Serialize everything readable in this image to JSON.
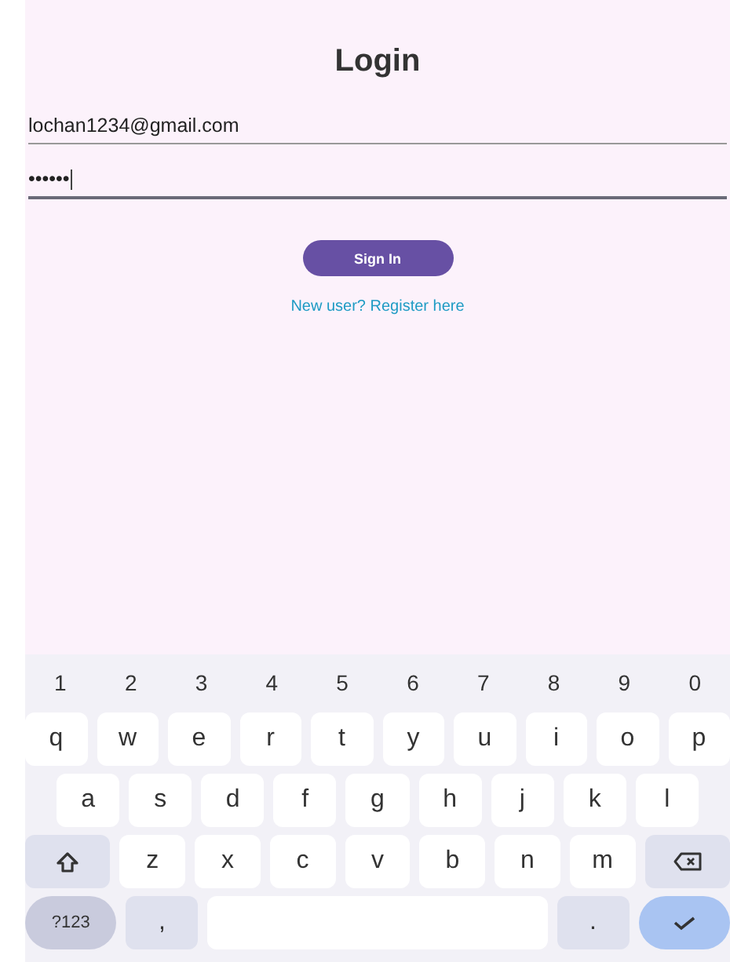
{
  "screen": {
    "title": "Login"
  },
  "form": {
    "email": {
      "value": "lochan1234@gmail.com",
      "focused": false
    },
    "password": {
      "value": "••••••",
      "focused": true
    },
    "sign_in_button": "Sign In",
    "register_link": "New user? Register here"
  },
  "keyboard": {
    "rows": [
      [
        {
          "kind": "digit",
          "label": "1"
        },
        {
          "kind": "digit",
          "label": "2"
        },
        {
          "kind": "digit",
          "label": "3"
        },
        {
          "kind": "digit",
          "label": "4"
        },
        {
          "kind": "digit",
          "label": "5"
        },
        {
          "kind": "digit",
          "label": "6"
        },
        {
          "kind": "digit",
          "label": "7"
        },
        {
          "kind": "digit",
          "label": "8"
        },
        {
          "kind": "digit",
          "label": "9"
        },
        {
          "kind": "digit",
          "label": "0"
        }
      ],
      [
        {
          "kind": "letter",
          "label": "q"
        },
        {
          "kind": "letter",
          "label": "w"
        },
        {
          "kind": "letter",
          "label": "e"
        },
        {
          "kind": "letter",
          "label": "r"
        },
        {
          "kind": "letter",
          "label": "t"
        },
        {
          "kind": "letter",
          "label": "y"
        },
        {
          "kind": "letter",
          "label": "u"
        },
        {
          "kind": "letter",
          "label": "i"
        },
        {
          "kind": "letter",
          "label": "o"
        },
        {
          "kind": "letter",
          "label": "p"
        }
      ],
      [
        {
          "kind": "letter",
          "label": "a"
        },
        {
          "kind": "letter",
          "label": "s"
        },
        {
          "kind": "letter",
          "label": "d"
        },
        {
          "kind": "letter",
          "label": "f"
        },
        {
          "kind": "letter",
          "label": "g"
        },
        {
          "kind": "letter",
          "label": "h"
        },
        {
          "kind": "letter",
          "label": "j"
        },
        {
          "kind": "letter",
          "label": "k"
        },
        {
          "kind": "letter",
          "label": "l"
        }
      ],
      [
        {
          "kind": "shift"
        },
        {
          "kind": "letter",
          "label": "z"
        },
        {
          "kind": "letter",
          "label": "x"
        },
        {
          "kind": "letter",
          "label": "c"
        },
        {
          "kind": "letter",
          "label": "v"
        },
        {
          "kind": "letter",
          "label": "b"
        },
        {
          "kind": "letter",
          "label": "n"
        },
        {
          "kind": "letter",
          "label": "m"
        },
        {
          "kind": "backspace"
        }
      ],
      [
        {
          "kind": "symbols",
          "label": "?123"
        },
        {
          "kind": "punct",
          "label": ","
        },
        {
          "kind": "space"
        },
        {
          "kind": "punct",
          "label": "."
        },
        {
          "kind": "enter"
        }
      ]
    ]
  }
}
